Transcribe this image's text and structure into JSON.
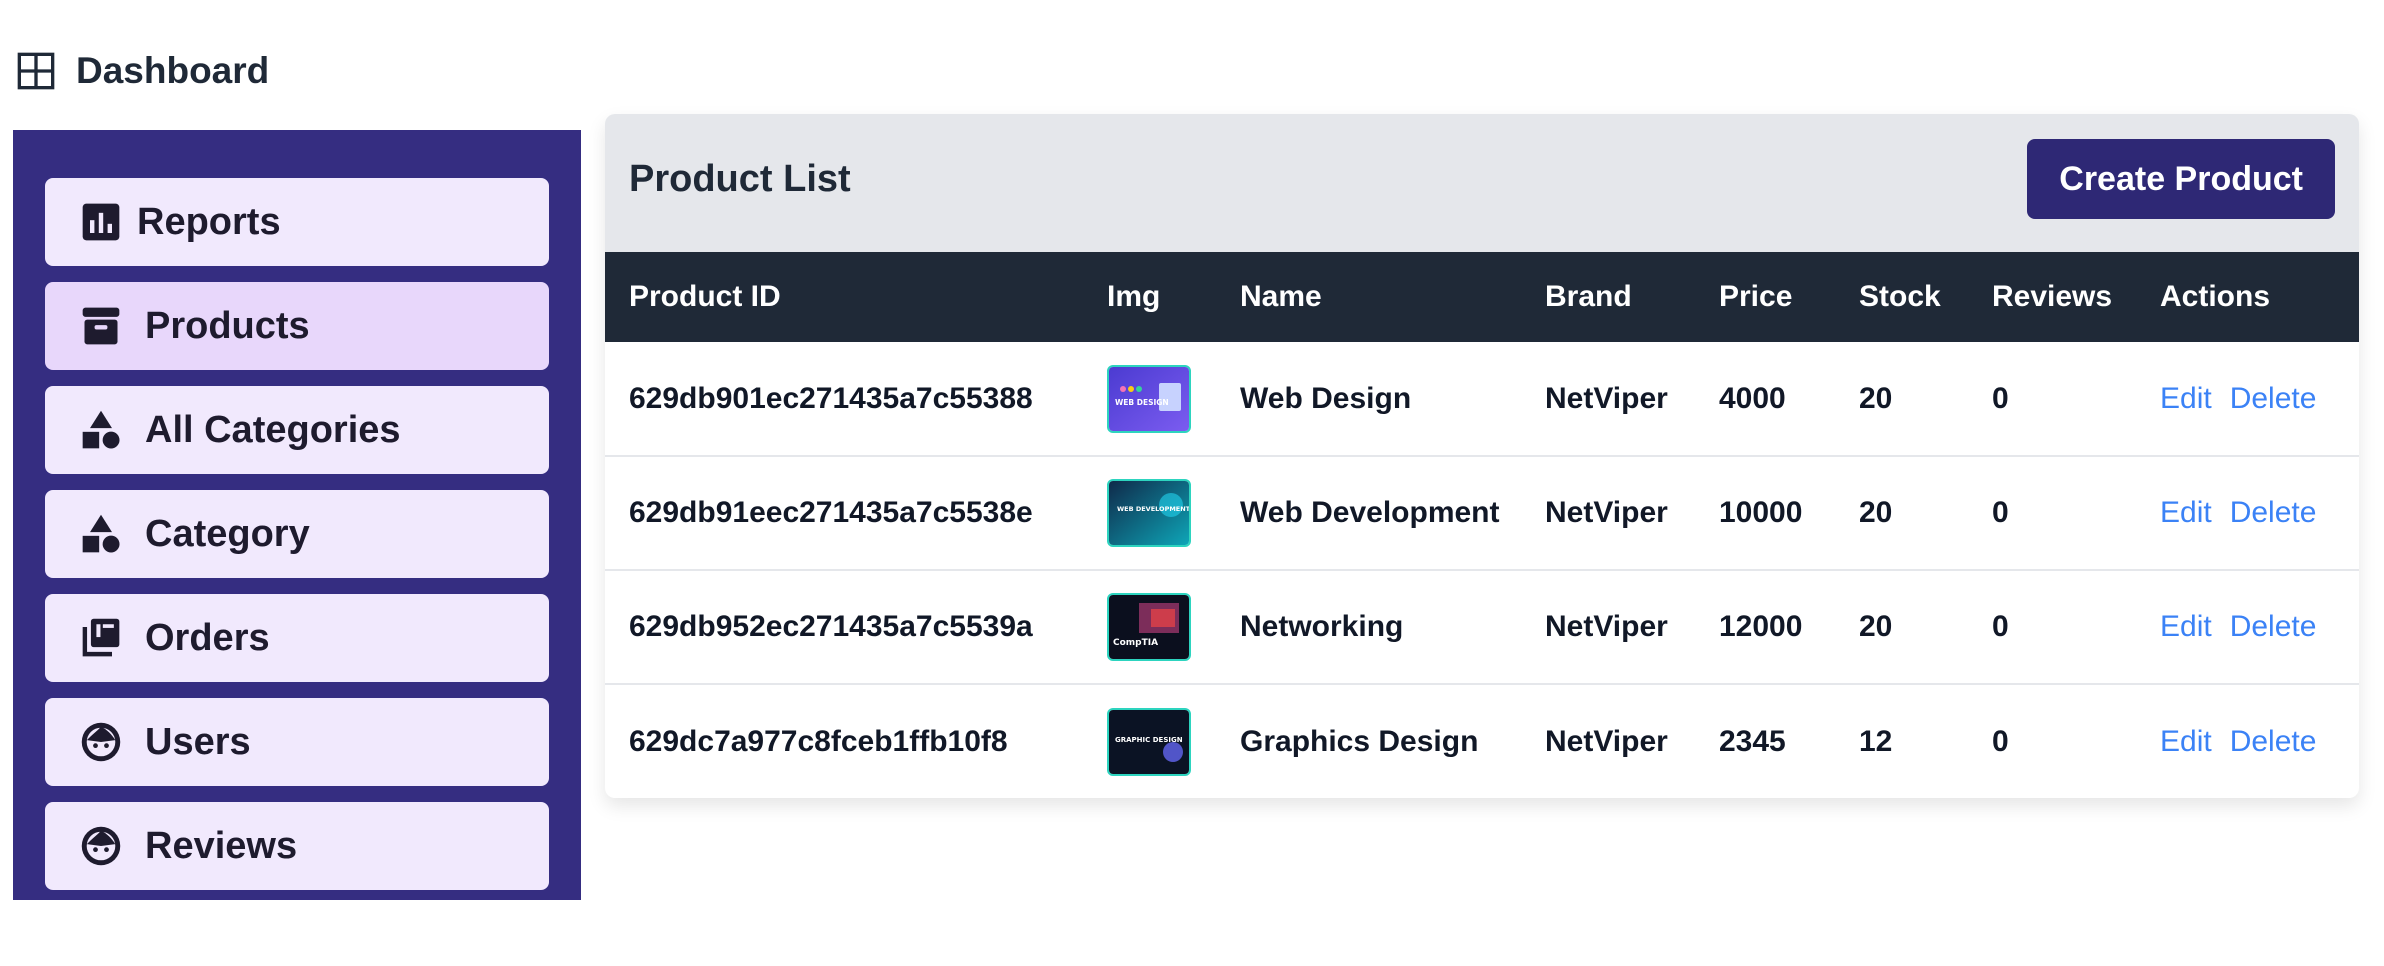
{
  "header": {
    "title": "Dashboard",
    "icon": "grid-icon"
  },
  "sidebar": {
    "items": [
      {
        "label": "Reports",
        "icon": "bar-chart-icon"
      },
      {
        "label": "Products",
        "icon": "archive-box-icon",
        "active": true
      },
      {
        "label": "All Categories",
        "icon": "shapes-icon"
      },
      {
        "label": "Category",
        "icon": "shapes-icon"
      },
      {
        "label": "Orders",
        "icon": "library-books-icon"
      },
      {
        "label": "Users",
        "icon": "face-icon"
      },
      {
        "label": "Reviews",
        "icon": "face-icon"
      }
    ]
  },
  "panel": {
    "title": "Product List",
    "create_label": "Create Product"
  },
  "table": {
    "columns": [
      "Product ID",
      "Img",
      "Name",
      "Brand",
      "Price",
      "Stock",
      "Reviews",
      "Actions"
    ],
    "rows": [
      {
        "id": "629db901ec271435a7c55388",
        "name": "Web Design",
        "brand": "NetViper",
        "price": "4000",
        "stock": "20",
        "reviews": "0",
        "edit": "Edit",
        "delete": "Delete",
        "thumb_text": "WEB DESIGN"
      },
      {
        "id": "629db91eec271435a7c5538e",
        "name": "Web Development",
        "brand": "NetViper",
        "price": "10000",
        "stock": "20",
        "reviews": "0",
        "edit": "Edit",
        "delete": "Delete",
        "thumb_text": "WEB DEVELOPMENT"
      },
      {
        "id": "629db952ec271435a7c5539a",
        "name": "Networking",
        "brand": "NetViper",
        "price": "12000",
        "stock": "20",
        "reviews": "0",
        "edit": "Edit",
        "delete": "Delete",
        "thumb_text": "CompTIA"
      },
      {
        "id": "629dc7a977c8fceb1ffb10f8",
        "name": "Graphics Design",
        "brand": "NetViper",
        "price": "2345",
        "stock": "12",
        "reviews": "0",
        "edit": "Edit",
        "delete": "Delete",
        "thumb_text": "GRAPHIC DESIGN"
      }
    ]
  },
  "colors": {
    "sidebar_bg": "#352d81",
    "item_bg": "#f1e9fd",
    "item_active_bg": "#e8d7fb",
    "table_head_bg": "#1f2937",
    "button_bg": "#2e2875",
    "link": "#3b82f6"
  }
}
